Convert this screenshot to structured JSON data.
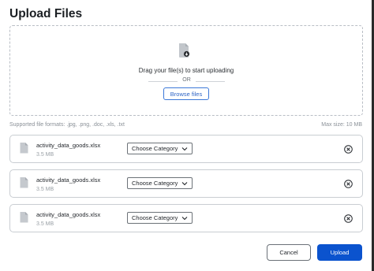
{
  "dialog": {
    "title": "Upload Files"
  },
  "dropzone": {
    "icon": "file-upload-icon",
    "instruction": "Drag your file(s) to start uploading",
    "or_text": "OR",
    "browse_label": "Browse files"
  },
  "info": {
    "supported_formats": "Supported file formats: .jpg, .png, .doc, .xls, .txt",
    "max_size": "Max size: 10 MB"
  },
  "files": [
    {
      "name": "activity_data_goods.xlsx",
      "size": "3.5 MB",
      "category": "Choose Category"
    },
    {
      "name": "activity_data_goods.xlsx",
      "size": "3.5 MB",
      "category": "Choose Category"
    },
    {
      "name": "activity_data_goods.xlsx",
      "size": "3.5 MB",
      "category": "Choose Category"
    }
  ],
  "actions": {
    "cancel_label": "Cancel",
    "upload_label": "Upload"
  },
  "colors": {
    "primary": "#0b53ce",
    "link": "#2f65c6",
    "border": "#c9cdd2"
  }
}
